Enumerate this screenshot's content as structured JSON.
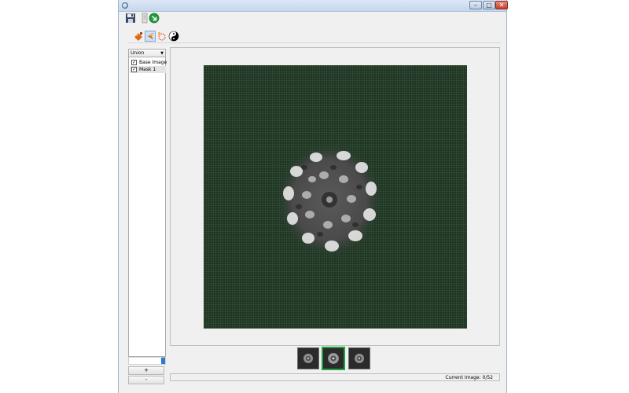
{
  "titlebar": {
    "icon": "app-icon",
    "buttons": {
      "minimize": "–",
      "maximize": "□",
      "close": "✕"
    }
  },
  "toolbar1": {
    "icons": [
      "save-icon",
      "document-icon",
      "go-icon"
    ]
  },
  "toolbar2": {
    "icons": [
      "paint-bucket-icon",
      "selection-arrow-icon",
      "lasso-icon",
      "yin-yang-icon"
    ]
  },
  "layers": {
    "blend_mode": "Union",
    "items": [
      {
        "label": "Base Image",
        "checked": true,
        "selected": false
      },
      {
        "label": "Mask 1",
        "checked": true,
        "selected": true
      }
    ],
    "add_label": "+",
    "remove_label": "-"
  },
  "viewer": {
    "background_color": "#1f3324"
  },
  "thumbnails": {
    "count": 3,
    "active_index": 1,
    "active_color": "#1fa33a"
  },
  "status": {
    "text": "Current Image: 0/52"
  }
}
